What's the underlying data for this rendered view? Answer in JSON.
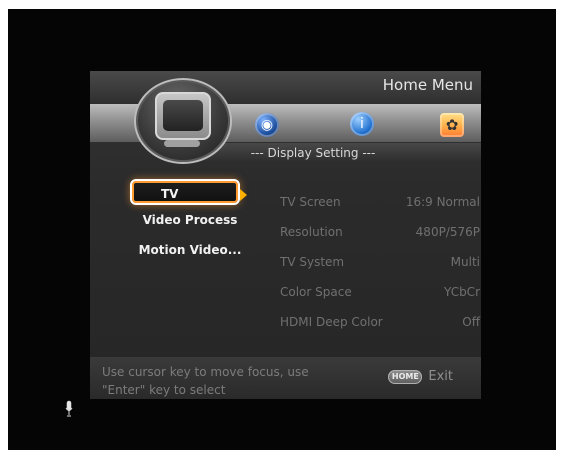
{
  "header": {
    "title": "Home Menu"
  },
  "section": {
    "title": "--- Display Setting ---"
  },
  "icons": {
    "monitor": "monitor-icon",
    "globe": "globe-icon",
    "info": "info-icon",
    "settings": "settings-icon",
    "mic": "microphone-icon"
  },
  "menu": {
    "items": [
      {
        "label": "TV"
      },
      {
        "label": "Video Process"
      },
      {
        "label": "Motion Video..."
      }
    ]
  },
  "settings": {
    "rows": [
      {
        "label": "TV Screen",
        "value": "16:9 Normal"
      },
      {
        "label": "Resolution",
        "value": "480P/576P"
      },
      {
        "label": "TV System",
        "value": "Multi"
      },
      {
        "label": "Color Space",
        "value": "YCbCr"
      },
      {
        "label": "HDMI Deep Color",
        "value": "Off"
      }
    ]
  },
  "help": {
    "line1": "Use cursor key to move focus, use",
    "line2": "\"Enter\" key to select"
  },
  "exit": {
    "button": "HOME",
    "label": "Exit"
  },
  "colors": {
    "focus_orange": "#ff9b2f",
    "focus_white": "#ffffff"
  }
}
